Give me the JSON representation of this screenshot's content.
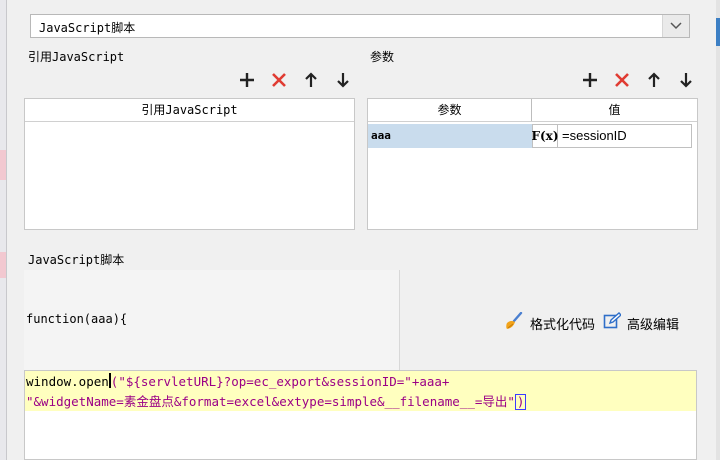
{
  "script_type": {
    "selected": "JavaScript脚本"
  },
  "left_section": {
    "title": "引用JavaScript",
    "column_header": "引用JavaScript"
  },
  "right_section": {
    "title": "参数",
    "columns": [
      "参数",
      "值"
    ],
    "rows": [
      {
        "name": "aaa",
        "fx_label": "F(x)",
        "value": "=sessionID"
      }
    ]
  },
  "script_section": {
    "title": "JavaScript脚本",
    "function_signature": "function(aaa){",
    "format_label": "格式化代码",
    "advanced_label": "高级编辑",
    "code_line1_fn": "window.open",
    "code_line1_paren": "(",
    "code_line1_rest": "\"${servletURL}?op=ec_export&sessionID=\"+aaa+",
    "code_line2_text": "\"&widgetName=素金盘点&format=excel&extype=simple&__filename__=导出\"",
    "code_line2_paren": ")"
  },
  "colors": {
    "add": "#222222",
    "delete": "#e03b32",
    "highlight": "#ffffbf",
    "selected_cell": "#c9dced",
    "code_string": "#9b0086"
  }
}
